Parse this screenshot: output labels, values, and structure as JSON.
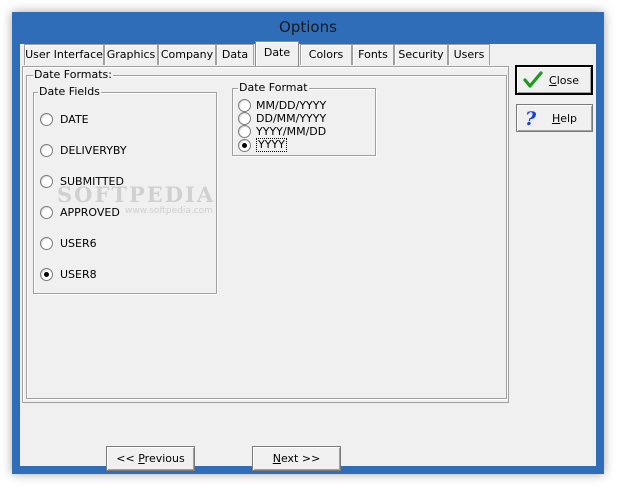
{
  "window": {
    "title": "Options"
  },
  "tabs": [
    {
      "label": "User Interface",
      "active": false
    },
    {
      "label": "Graphics",
      "active": false
    },
    {
      "label": "Company",
      "active": false
    },
    {
      "label": "Data",
      "active": false
    },
    {
      "label": "Date",
      "active": true
    },
    {
      "label": "Colors",
      "active": false
    },
    {
      "label": "Fonts",
      "active": false
    },
    {
      "label": "Security",
      "active": false
    },
    {
      "label": "Users",
      "active": false
    }
  ],
  "date_formats": {
    "group_label": "Date Formats:",
    "date_fields": {
      "label": "Date Fields",
      "options": [
        {
          "label": "DATE",
          "checked": false
        },
        {
          "label": "DELIVERYBY",
          "checked": false
        },
        {
          "label": "SUBMITTED",
          "checked": false
        },
        {
          "label": "APPROVED",
          "checked": false
        },
        {
          "label": "USER6",
          "checked": false
        },
        {
          "label": "USER8",
          "checked": true
        }
      ]
    },
    "date_format": {
      "label": "Date Format",
      "options": [
        {
          "label": "MM/DD/YYYY",
          "checked": false
        },
        {
          "label": "DD/MM/YYYY",
          "checked": false
        },
        {
          "label": "YYYY/MM/DD",
          "checked": false
        },
        {
          "label": "YYYY",
          "checked": true
        }
      ]
    }
  },
  "buttons": {
    "close": {
      "label": "Close",
      "underline": "C",
      "rest": "lose"
    },
    "help": {
      "label": "Help",
      "underline": "H",
      "rest": "elp"
    },
    "previous": {
      "prefix": "<< ",
      "underline": "P",
      "rest": "revious"
    },
    "next": {
      "underline": "N",
      "rest": "ext >>"
    }
  },
  "watermark": {
    "text": "SOFTPEDIA",
    "sub": "www.softpedia.com"
  },
  "colors": {
    "frame": "#2f6db8",
    "face": "#f0f0f0",
    "check_green": "#1e9a1e",
    "help_blue": "#1c3fd6"
  }
}
